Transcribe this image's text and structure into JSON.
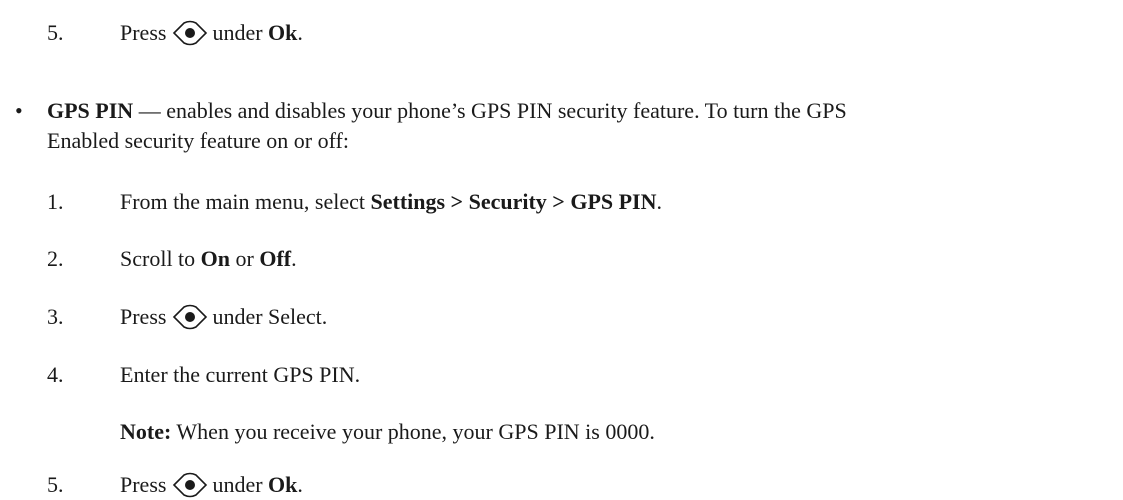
{
  "step_prev5": {
    "num": "5.",
    "press": "Press",
    "under": "under",
    "target": "Ok",
    "end": "."
  },
  "bullet_char": "•",
  "gps_pin": {
    "term": "GPS PIN",
    "description_line1": " — enables and disables your phone’s GPS PIN security feature. To turn the GPS",
    "description_line2": "Enabled security feature on or off:"
  },
  "steps": {
    "s1": {
      "num": "1.",
      "text": "From the main menu, select ",
      "path": "Settings > Security > GPS PIN",
      "end": "."
    },
    "s2": {
      "num": "2.",
      "text": "Scroll to ",
      "opt1": "On",
      "or": " or ",
      "opt2": "Off",
      "end": "."
    },
    "s3": {
      "num": "3.",
      "press": "Press",
      "after": "under Select."
    },
    "s4": {
      "num": "4.",
      "text": "Enter the current GPS PIN."
    },
    "note": {
      "label": "Note:",
      "text": " When you receive your phone, your GPS PIN is 0000."
    },
    "s5": {
      "num": "5.",
      "press": "Press",
      "under": "under",
      "target": "Ok",
      "end": "."
    }
  },
  "icon": "menu-ok-key-icon"
}
